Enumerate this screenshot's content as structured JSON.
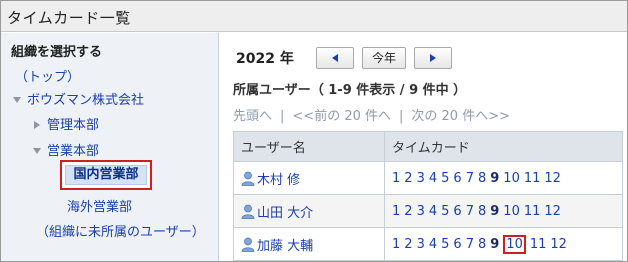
{
  "page": {
    "title": "タイムカード一覧"
  },
  "tree": {
    "header": "組織を選択する",
    "top_link": "（トップ）",
    "company": "ボウズマン株式会社",
    "dept_admin": "管理本部",
    "dept_sales": "営業本部",
    "selected": "国内営業部",
    "overseas": "海外営業部",
    "unassigned": "（組織に未所属のユーザー）"
  },
  "toolbar": {
    "year": "2022 年",
    "today_label": "今年"
  },
  "list": {
    "count_text": "所属ユーザー（ 1-9 件表示 / 9 件中 ）",
    "pager": {
      "first": "先頭へ",
      "prev": "<<前の 20 件へ",
      "next": "次の 20 件へ>>"
    },
    "columns": {
      "user": "ユーザー名",
      "timecard": "タイムカード"
    },
    "month_labels": [
      "1",
      "2",
      "3",
      "4",
      "5",
      "6",
      "7",
      "8",
      "9",
      "10",
      "11",
      "12"
    ],
    "current_month": "9",
    "highlighted_month": "10",
    "rows": [
      {
        "name": "木村 修"
      },
      {
        "name": "山田 大介"
      },
      {
        "name": "加藤 大輔"
      }
    ]
  },
  "colors": {
    "link": "#1a3fb0",
    "highlight_border": "#d11f1f",
    "selected_bg": "#d5e3f7"
  }
}
